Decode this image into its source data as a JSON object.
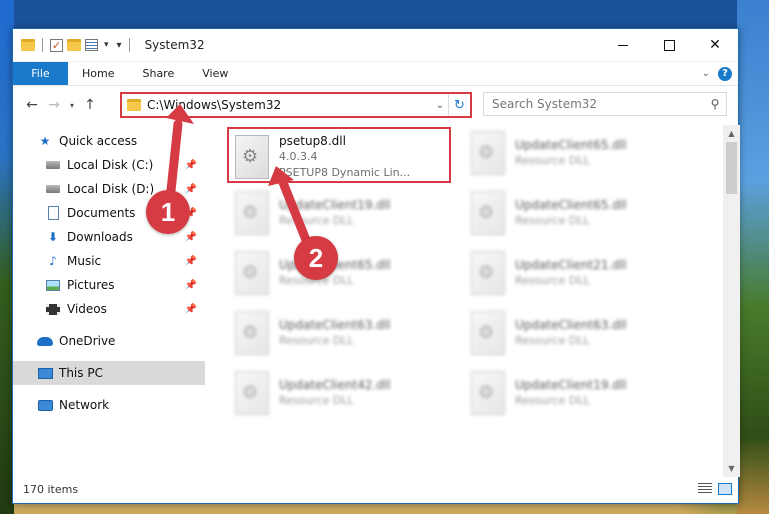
{
  "window": {
    "title": "System32"
  },
  "ribbon": {
    "tabs": [
      "File",
      "Home",
      "Share",
      "View"
    ],
    "help_label": "?"
  },
  "address": {
    "path": "C:\\Windows\\System32",
    "search_placeholder": "Search System32"
  },
  "sidebar": {
    "quick_access": "Quick access",
    "items": [
      {
        "label": "Local Disk (C:)",
        "icon": "local-disk-icon"
      },
      {
        "label": "Local Disk (D:)",
        "icon": "local-disk-icon"
      },
      {
        "label": "Documents",
        "icon": "documents-icon"
      },
      {
        "label": "Downloads",
        "icon": "downloads-icon"
      },
      {
        "label": "Music",
        "icon": "music-icon"
      },
      {
        "label": "Pictures",
        "icon": "pictures-icon"
      },
      {
        "label": "Videos",
        "icon": "videos-icon"
      }
    ],
    "onedrive": "OneDrive",
    "this_pc": "This PC",
    "network": "Network"
  },
  "files": [
    {
      "name": "psetup8.dll",
      "line2": "4.0.3.4",
      "line3": "PSETUP8 Dynamic Lin..."
    },
    {
      "name": "UpdateClient65.dll",
      "line2": "Resource DLL"
    },
    {
      "name": "UpdateClient19.dll",
      "line2": "Resource DLL"
    },
    {
      "name": "UpdateClient65.dll",
      "line2": "Resource DLL"
    },
    {
      "name": "UpdateClient65.dll",
      "line2": "Resource DLL"
    },
    {
      "name": "UpdateClient21.dll",
      "line2": "Resource DLL"
    },
    {
      "name": "UpdateClient63.dll",
      "line2": "Resource DLL"
    },
    {
      "name": "UpdateClient63.dll",
      "line2": "Resource DLL"
    },
    {
      "name": "UpdateClient42.dll",
      "line2": "Resource DLL"
    },
    {
      "name": "UpdateClient19.dll",
      "line2": "Resource DLL"
    }
  ],
  "status": {
    "item_count": "170 items"
  },
  "annotations": {
    "step1": "1",
    "step2": "2",
    "color": "#d63a43"
  }
}
